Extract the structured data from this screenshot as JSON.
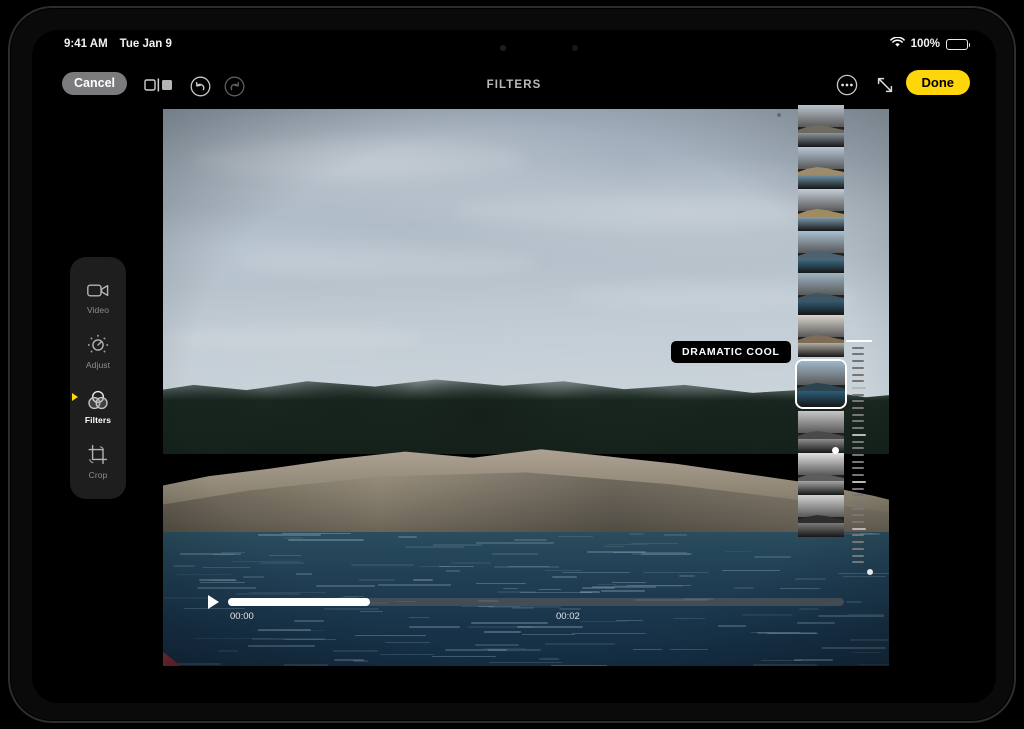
{
  "statusbar": {
    "time": "9:41 AM",
    "date": "Tue Jan 9",
    "wifi_icon": "wifi-icon",
    "battery_percent": "100%",
    "battery_level": 100
  },
  "toolbar": {
    "cancel_label": "Cancel",
    "compare_icon": "compare-icon",
    "undo_icon": "undo-icon",
    "redo_icon": "redo-icon",
    "title": "FILTERS",
    "more_icon": "more-options-icon",
    "expand_icon": "expand-icon",
    "done_label": "Done"
  },
  "tools": [
    {
      "label": "Video",
      "icon": "video-camera-icon",
      "active": false
    },
    {
      "label": "Adjust",
      "icon": "adjust-dial-icon",
      "active": false
    },
    {
      "label": "Filters",
      "icon": "filters-circles-icon",
      "active": true
    },
    {
      "label": "Crop",
      "icon": "crop-rotate-icon",
      "active": false
    }
  ],
  "scrubber": {
    "play_icon": "play-icon",
    "start_time": "00:00",
    "end_time": "00:02",
    "progress_percent": 23
  },
  "filters": {
    "tooltip_label": "DRAMATIC COOL",
    "selected_index": 6,
    "thumbnails": [
      {
        "name": "original",
        "sky": "#b9c3cc",
        "land": "#6e6a60",
        "water": "#8b949c"
      },
      {
        "name": "vivid",
        "sky": "#b7c8d6",
        "land": "#9c8b6c",
        "water": "#6d93a8"
      },
      {
        "name": "vivid-warm",
        "sky": "#c4cdd6",
        "land": "#a08b63",
        "water": "#7d9db0"
      },
      {
        "name": "vivid-cool",
        "sky": "#a8c0d2",
        "land": "#4c6270",
        "water": "#3d6d86"
      },
      {
        "name": "dramatic",
        "sky": "#9db4c4",
        "land": "#3f5562",
        "water": "#2f5c74"
      },
      {
        "name": "dramatic-warm",
        "sky": "#d9d5cc",
        "land": "#7d6c56",
        "water": "#b2ada4"
      },
      {
        "name": "dramatic-cool",
        "sky": "#9fb8c9",
        "land": "#2c4450",
        "water": "#2a5d78"
      },
      {
        "name": "mono",
        "sky": "#c7c7c7",
        "land": "#4a4a4a",
        "water": "#8e8e8e"
      },
      {
        "name": "silvertone",
        "sky": "#e2e2e2",
        "land": "#5c5c5c",
        "water": "#a6a6a6"
      },
      {
        "name": "noir",
        "sky": "#d2d2d2",
        "land": "#2e2e2e",
        "water": "#7a7a7a"
      }
    ],
    "scroll_dot_top": "scroll-indicator-dot",
    "scroll_dot_bottom": "scroll-indicator-dot"
  },
  "intensity_slider": {
    "name": "filter-intensity-slider",
    "value_position_percent": 47,
    "tick_count": 34
  },
  "colors": {
    "accent_yellow": "#ffd60a",
    "cancel_gray": "#7b7b7e",
    "rail_bg": "#1e1e1e",
    "title_gray": "#b9b9b9"
  }
}
